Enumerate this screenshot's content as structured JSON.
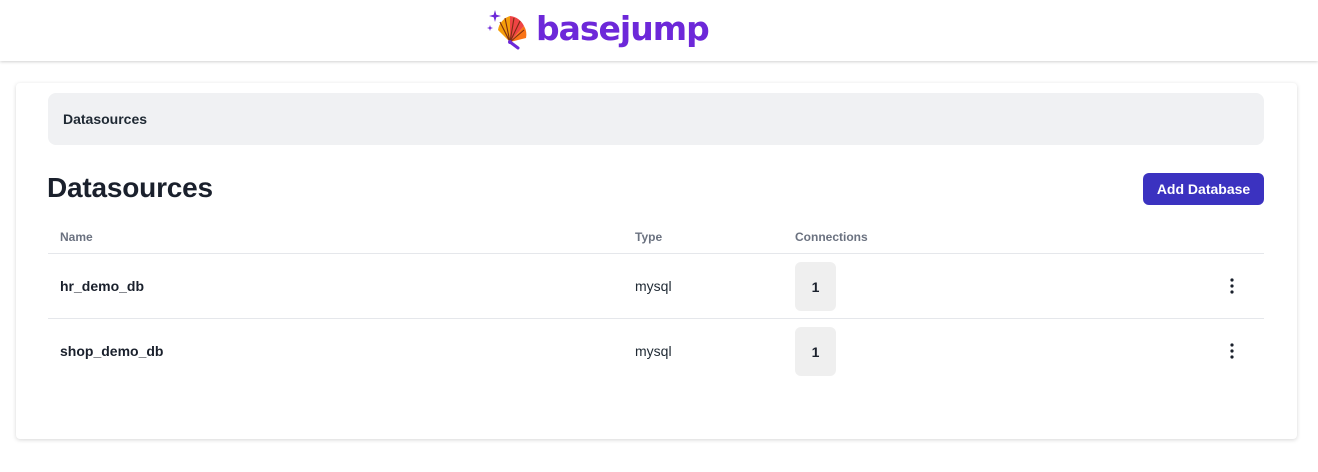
{
  "brand": {
    "name": "basejump",
    "logo_icon": "fan-sparkle-icon",
    "color": "#6d28d9"
  },
  "breadcrumb": {
    "label": "Datasources"
  },
  "page": {
    "title": "Datasources",
    "add_button_label": "Add Database",
    "accent_color": "#3b32c0"
  },
  "table": {
    "columns": {
      "name": "Name",
      "type": "Type",
      "connections": "Connections"
    },
    "rows": [
      {
        "name": "hr_demo_db",
        "type": "mysql",
        "connections": "1",
        "menu_icon": "more-vertical-icon"
      },
      {
        "name": "shop_demo_db",
        "type": "mysql",
        "connections": "1",
        "menu_icon": "more-vertical-icon"
      }
    ]
  }
}
